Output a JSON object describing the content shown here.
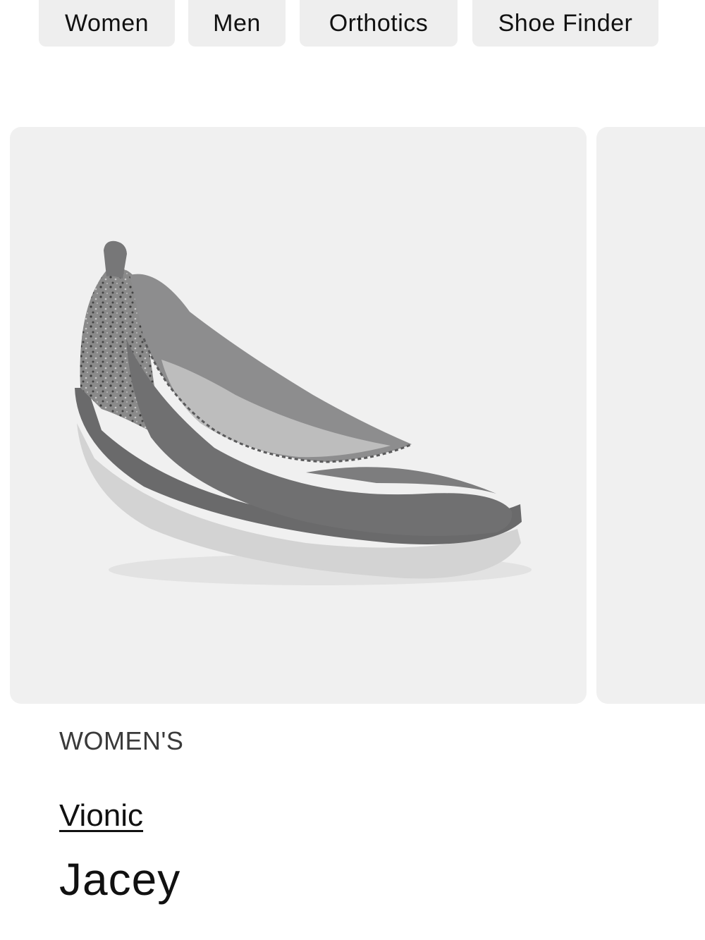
{
  "nav": {
    "chips": [
      {
        "label": "Women"
      },
      {
        "label": "Men"
      },
      {
        "label": "Orthotics"
      },
      {
        "label": "Shoe Finder"
      }
    ]
  },
  "product": {
    "image_icon": "shoe-image",
    "category": "WOMEN'S",
    "brand": "Vionic",
    "name": "Jacey"
  },
  "colors": {
    "card_bg": "#f0f0f0",
    "chip_bg": "#eeeeee",
    "shoe_upper": "#6f6f70",
    "shoe_sole": "#d0d0d0"
  }
}
